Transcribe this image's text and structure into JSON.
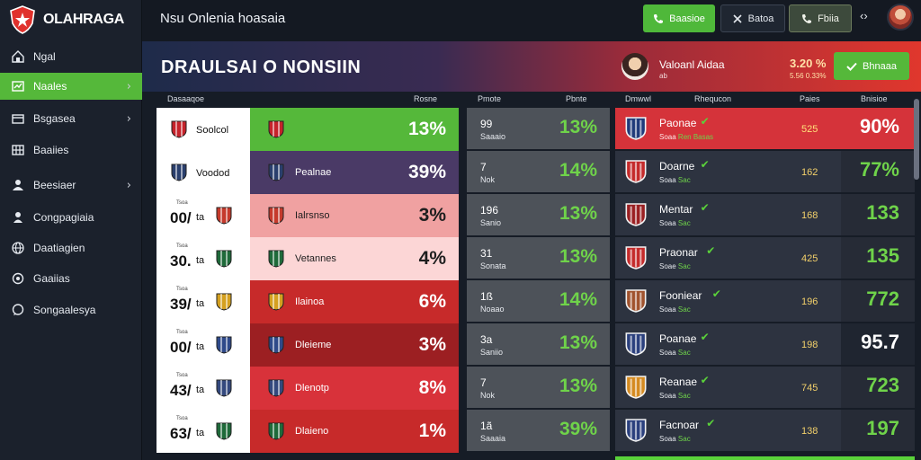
{
  "app": {
    "logo_text": "OLAHRAGA",
    "title": "Nsu Onlenia hoasaia"
  },
  "sidebar": {
    "items": [
      {
        "label": "Ngal",
        "icon": "home-icon",
        "chevron": false,
        "active": false
      },
      {
        "label": "Naales",
        "icon": "chart-icon",
        "chevron": true,
        "active": true
      },
      {
        "label": "Bsgasea",
        "icon": "card-icon",
        "chevron": true,
        "active": false
      },
      {
        "label": "Baaiies",
        "icon": "grid-icon",
        "chevron": false,
        "active": false
      },
      {
        "label": "Beesiaer",
        "icon": "person-icon",
        "chevron": true,
        "active": false
      },
      {
        "label": "Congpagiaia",
        "icon": "user-icon",
        "chevron": false,
        "active": false
      },
      {
        "label": "Daatiagien",
        "icon": "globe-icon",
        "chevron": false,
        "active": false
      },
      {
        "label": "Gaaiias",
        "icon": "settings-icon",
        "chevron": false,
        "active": false
      },
      {
        "label": "Songaalesya",
        "icon": "chat-icon",
        "chevron": false,
        "active": false
      }
    ]
  },
  "topbar": {
    "btn1_label": "Baasioe",
    "btn2_label": "Batoa",
    "btn3_label": "Fbiia",
    "more_label": "‹›"
  },
  "banner": {
    "title": "DRAULSAI O NONSIIN",
    "user_name": "Valoanl Aidaa",
    "user_sub": "ab",
    "odds_a": "3.20 %",
    "odds_b": "5.56 0.33%",
    "action_label": "Bhnaaa"
  },
  "headers": {
    "left_a": "Dasaaqoe",
    "left_b": "Rosne",
    "left_c": "Pmote",
    "mid_b": "Pbnte",
    "right_a": "Dmwwl",
    "right_b": "Rhequcon",
    "right_c": "Paies",
    "right_d": "Bnisioe"
  },
  "left_table": [
    {
      "small": "",
      "score": "",
      "team": "Soolcol",
      "right_name": "",
      "pct": "13%",
      "right_bg": "#55b83a",
      "pct_color": "#ffffff",
      "crest_color": "#c5232b"
    },
    {
      "small": "",
      "score": "",
      "team": "Voodod",
      "right_name": "Pealnae",
      "pct": "39%",
      "right_bg": "#4a3a66",
      "pct_color": "#ffffff",
      "crest_color": "#2a3f6d"
    },
    {
      "small": "Tsoa",
      "score": "00/",
      "team": "ta",
      "right_name": "Ialrsnso",
      "pct": "3%",
      "right_bg": "#f0a1a1",
      "pct_color": "#1e1e1e",
      "crest_color": "#c53a2c"
    },
    {
      "small": "Tsoa",
      "score": "30.",
      "team": "ta",
      "right_name": "Vetannes",
      "pct": "4%",
      "right_bg": "#fcd6d6",
      "pct_color": "#1e1e1e",
      "crest_color": "#1f6a3a"
    },
    {
      "small": "Tsoa",
      "score": "39/",
      "team": "ta",
      "right_name": "Ilainoa",
      "pct": "6%",
      "right_bg": "#c72a2a",
      "pct_color": "#ffffff",
      "crest_color": "#d4a020"
    },
    {
      "small": "Tsoa",
      "score": "00/",
      "team": "ta",
      "right_name": "Dleieme",
      "pct": "3%",
      "right_bg": "#9c1f22",
      "pct_color": "#ffffff",
      "crest_color": "#2f4a8a"
    },
    {
      "small": "Tsoa",
      "score": "43/",
      "team": "ta",
      "right_name": "Dlenotp",
      "pct": "8%",
      "right_bg": "#d8323a",
      "pct_color": "#ffffff",
      "crest_color": "#34497e"
    },
    {
      "small": "Tsoa",
      "score": "63/",
      "team": "ta",
      "right_name": "Dlaieno",
      "pct": "1%",
      "right_bg": "#c72a2a",
      "pct_color": "#ffffff",
      "crest_color": "#1f6a3a"
    }
  ],
  "mid_table": [
    {
      "value": "99",
      "sub": "Saaaio",
      "pct": "13%"
    },
    {
      "value": "7",
      "sub": "Nok",
      "pct": "14%"
    },
    {
      "value": "196",
      "sub": "Sanio",
      "pct": "13%"
    },
    {
      "value": "31",
      "sub": "Sonata",
      "pct": "13%"
    },
    {
      "value": "1ß",
      "sub": "Noaao",
      "pct": "14%"
    },
    {
      "value": "3a",
      "sub": "Saniio",
      "pct": "13%"
    },
    {
      "value": "7",
      "sub": "Nok",
      "pct": "13%"
    },
    {
      "value": "1ã",
      "sub": "Saaaia",
      "pct": "39%"
    }
  ],
  "right_table": [
    {
      "name": "Paonae",
      "sub_a": "Soaa",
      "sub_b": "Ren Basas",
      "odds": "525",
      "pct": "90%",
      "style": "hot",
      "badge_color": "#1f3a7a"
    },
    {
      "name": "Doarne",
      "sub_a": "Soaa",
      "sub_b": "Sac",
      "odds": "162",
      "pct": "77%",
      "style": "",
      "badge_color": "#c42a2a"
    },
    {
      "name": "Mentar",
      "sub_a": "Soaa",
      "sub_b": "Sac",
      "odds": "168",
      "pct": "133",
      "style": "",
      "badge_color": "#9a1f22"
    },
    {
      "name": "Praonar",
      "sub_a": "Soae",
      "sub_b": "Sac",
      "odds": "425",
      "pct": "135",
      "style": "",
      "badge_color": "#c42a2a"
    },
    {
      "name": "Fooniear",
      "sub_a": "Soaa",
      "sub_b": "Sac",
      "odds": "196",
      "pct": "772",
      "style": "",
      "badge_color": "#a0522d"
    },
    {
      "name": "Poanae",
      "sub_a": "Soaa",
      "sub_b": "Sac",
      "odds": "198",
      "pct": "95.7",
      "style": "light",
      "badge_color": "#2a3f7d"
    },
    {
      "name": "Reanae",
      "sub_a": "Soaa",
      "sub_b": "Sac",
      "odds": "745",
      "pct": "723",
      "style": "",
      "badge_color": "#d48a20"
    },
    {
      "name": "Facnoar",
      "sub_a": "Soaa",
      "sub_b": "Sac",
      "odds": "138",
      "pct": "197",
      "style": "",
      "badge_color": "#2a3f7d"
    }
  ]
}
